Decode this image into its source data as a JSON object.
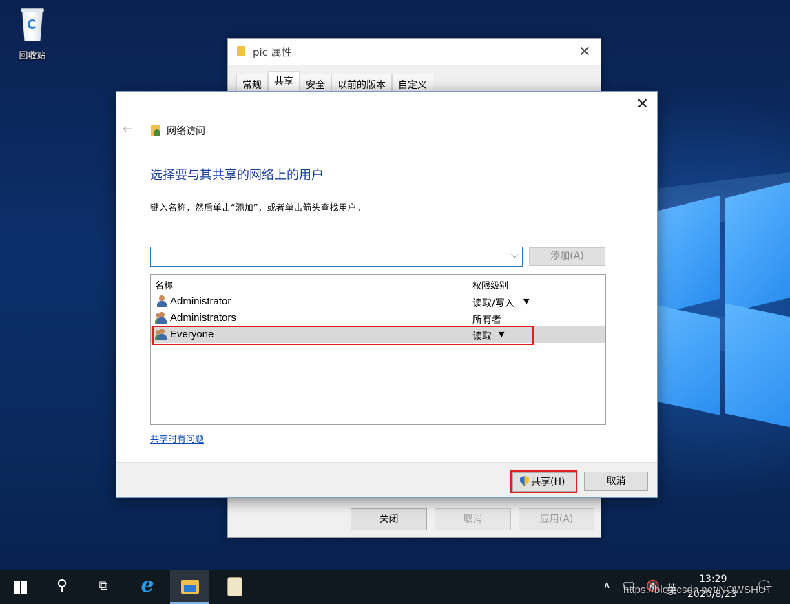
{
  "desktop": {
    "recycle_bin_label": "回收站"
  },
  "properties_window": {
    "title": "pic 属性",
    "tabs": [
      {
        "label": "常规",
        "active": false
      },
      {
        "label": "共享",
        "active": true
      },
      {
        "label": "安全",
        "active": false
      },
      {
        "label": "以前的版本",
        "active": false
      },
      {
        "label": "自定义",
        "active": false
      }
    ],
    "buttons": {
      "close": "关闭",
      "cancel": "取消",
      "apply": "应用(A)"
    }
  },
  "dialog": {
    "nav_title": "网络访问",
    "heading": "选择要与其共享的网络上的用户",
    "instruction": "键入名称，然后单击“添加”，或者单击箭头查找用户。",
    "combo_value": "",
    "add_button": "添加(A)",
    "columns": {
      "name": "名称",
      "permission": "权限级别"
    },
    "users": [
      {
        "name": "Administrator",
        "permission": "读取/写入",
        "has_dropdown": true,
        "icon": "user-icon"
      },
      {
        "name": "Administrators",
        "permission": "所有者",
        "has_dropdown": false,
        "icon": "user-group-icon"
      },
      {
        "name": "Everyone",
        "permission": "读取",
        "has_dropdown": true,
        "icon": "user-group-icon",
        "selected": true
      }
    ],
    "trouble_link": "共享时有问题",
    "share_button": "共享(H)",
    "cancel_button": "取消"
  },
  "taskbar": {
    "time": "13:29",
    "date": "2020/8/23",
    "ime": "英",
    "apps": [
      "start-icon",
      "search-icon",
      "task-view-icon",
      "internet-explorer-icon",
      "file-explorer-icon",
      "notepad-icon"
    ]
  },
  "watermark": "https://blog.csdn.net/NOWSHUT",
  "colors": {
    "heading_blue": "#1a3e9a",
    "link_blue": "#0a4bb5",
    "highlight_red": "#e0201f",
    "taskbar": "#101820"
  }
}
